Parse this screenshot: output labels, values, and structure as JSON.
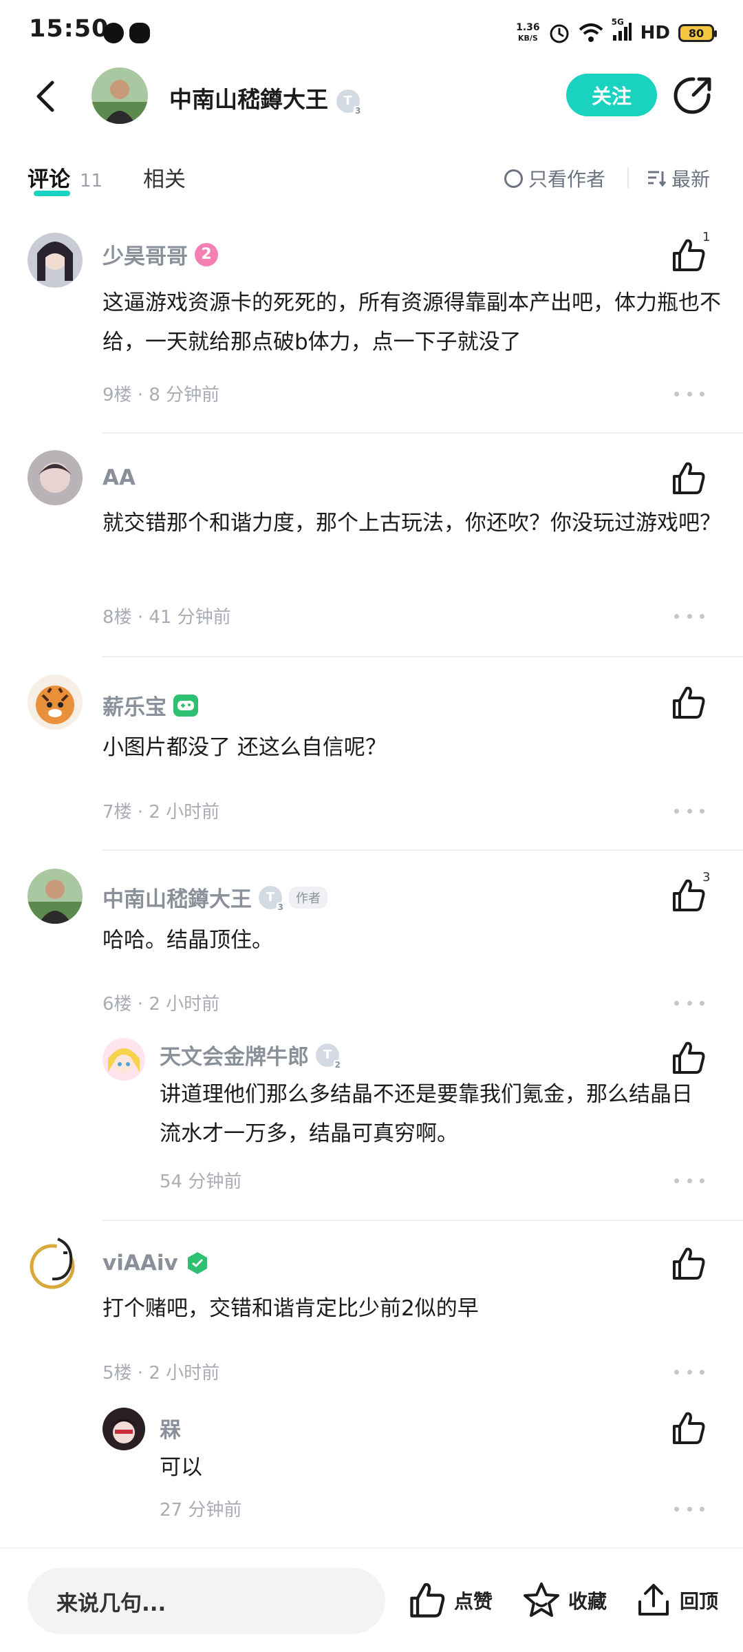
{
  "status_bar": {
    "time": "15:50",
    "net_speed_value": "1.36",
    "net_speed_unit": "KB/S",
    "signal_label": "5G",
    "hd_label": "HD",
    "battery": "80"
  },
  "header": {
    "author_name": "中南山嵇鐏大王",
    "level_letter": "T",
    "level_num": "3",
    "follow_label": "关注"
  },
  "tabs": {
    "comments_label": "评论",
    "comments_count": "11",
    "related_label": "相关",
    "author_only_label": "只看作者",
    "sort_label": "最新"
  },
  "comments": [
    {
      "username": "少昊哥哥",
      "badge": "2",
      "text": "这逼游戏资源卡的死死的，所有资源得靠副本产出吧，体力瓶也不给，一天就给那点破b体力，点一下子就没了",
      "meta": "9楼 · 8 分钟前",
      "likes": "1"
    },
    {
      "username": "AA",
      "text": "就交错那个和谐力度，那个上古玩法，你还吹？你没玩过游戏吧？",
      "meta": "8楼 · 41 分钟前"
    },
    {
      "username": "薪乐宝",
      "text": "小图片都没了 还这么自信呢？",
      "meta": "7楼 · 2 小时前"
    },
    {
      "username": "中南山嵇鐏大王",
      "level_letter": "T",
      "level_num": "3",
      "author_tag": "作者",
      "text": "哈哈。结晶顶住。",
      "meta": "6楼 · 2 小时前",
      "likes": "3",
      "reply": {
        "username": "天文会金牌牛郎",
        "level_letter": "T",
        "level_num": "2",
        "text": "讲道理他们那么多结晶不还是要靠我们氪金，那么结晶日流水才一万多，结晶可真穷啊。",
        "meta": "54 分钟前"
      }
    },
    {
      "username": "viAAiv",
      "text": "打个赌吧，交错和谐肯定比少前2似的早",
      "meta": "5楼 · 2 小时前",
      "reply": {
        "username": "槑",
        "text": "可以",
        "meta": "27 分钟前"
      }
    }
  ],
  "bottom_bar": {
    "input_placeholder": "来说几句...",
    "like_label": "点赞",
    "favorite_label": "收藏",
    "top_label": "回顶"
  },
  "colors": {
    "accent": "#19d2bf",
    "username": "#8a9099",
    "meta": "#a8adb5"
  }
}
